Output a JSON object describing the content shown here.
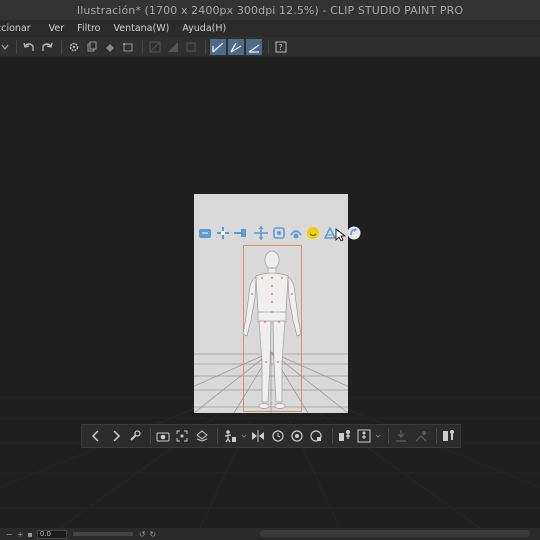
{
  "window": {
    "title": "Ilustración* (1700 x 2400px 300dpi 12.5%)  - CLIP STUDIO PAINT PRO"
  },
  "menu": {
    "items": [
      "ccionar",
      "Ver",
      "Filtro",
      "Ventana(W)",
      "Ayuda(H)"
    ]
  },
  "command_bar": {
    "icons": [
      "menu-chevron-icon",
      "undo-icon",
      "redo-icon",
      "gear-icon",
      "copy-icon",
      "fill-icon",
      "transform-icon",
      "clear-icon",
      "gradient-icon",
      "square-icon",
      "line-tool-1-icon",
      "line-tool-2-icon",
      "line-tool-3-icon",
      "help-icon"
    ]
  },
  "canvas": {
    "document_bg": "#d9d9d9",
    "workspace_bg": "#1f1f1f",
    "accent": "#5b9bd5",
    "selection_color": "#e08a6a"
  },
  "camera_toolbar": {
    "icons": [
      "prev-icon",
      "next-icon",
      "wrench-icon",
      "camera-icon",
      "frame-icon",
      "scene-icon",
      "pose-icon",
      "flip-icon",
      "reset-icon",
      "rotate-icon",
      "lock-icon",
      "figure-icon",
      "body-icon",
      "landing-icon",
      "ground-icon",
      "person-icon"
    ]
  },
  "status_bar": {
    "zoom_value": "0.0"
  }
}
